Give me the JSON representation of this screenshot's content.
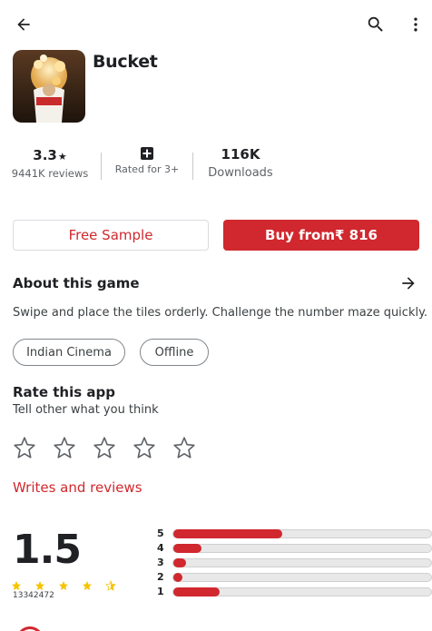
{
  "header": {
    "back_icon": "arrow-left-icon",
    "search_icon": "search-icon",
    "more_icon": "more-vert-icon"
  },
  "app": {
    "title": "Bucket"
  },
  "stats": {
    "rating": "3.3",
    "reviews": "9441K reviews",
    "content_rating_label": "Rated for 3+",
    "downloads": "116K",
    "downloads_label": "Downloads"
  },
  "actions": {
    "free_sample": "Free Sample",
    "buy": "Buy from₹ 816"
  },
  "about": {
    "title": "About this game",
    "description": "Swipe  and place the tiles orderly. Challenge the number maze quickly.",
    "tags": [
      "Indian Cinema",
      "Offline"
    ]
  },
  "rate": {
    "title": "Rate this app",
    "subtitle": "Tell other what you think",
    "star_count": 5
  },
  "reviews_link": "Writes and reviews",
  "summary": {
    "average": "1.5",
    "total": "13342472",
    "star_fill": 0.3,
    "bars": [
      {
        "label": "5",
        "fraction": 0.42
      },
      {
        "label": "4",
        "fraction": 0.11
      },
      {
        "label": "3",
        "fraction": 0.05
      },
      {
        "label": "2",
        "fraction": 0.035
      },
      {
        "label": "1",
        "fraction": 0.18
      }
    ]
  },
  "colors": {
    "accent": "#d0282e",
    "track": "#e8e8e8",
    "star_gold": "#f5c400"
  }
}
